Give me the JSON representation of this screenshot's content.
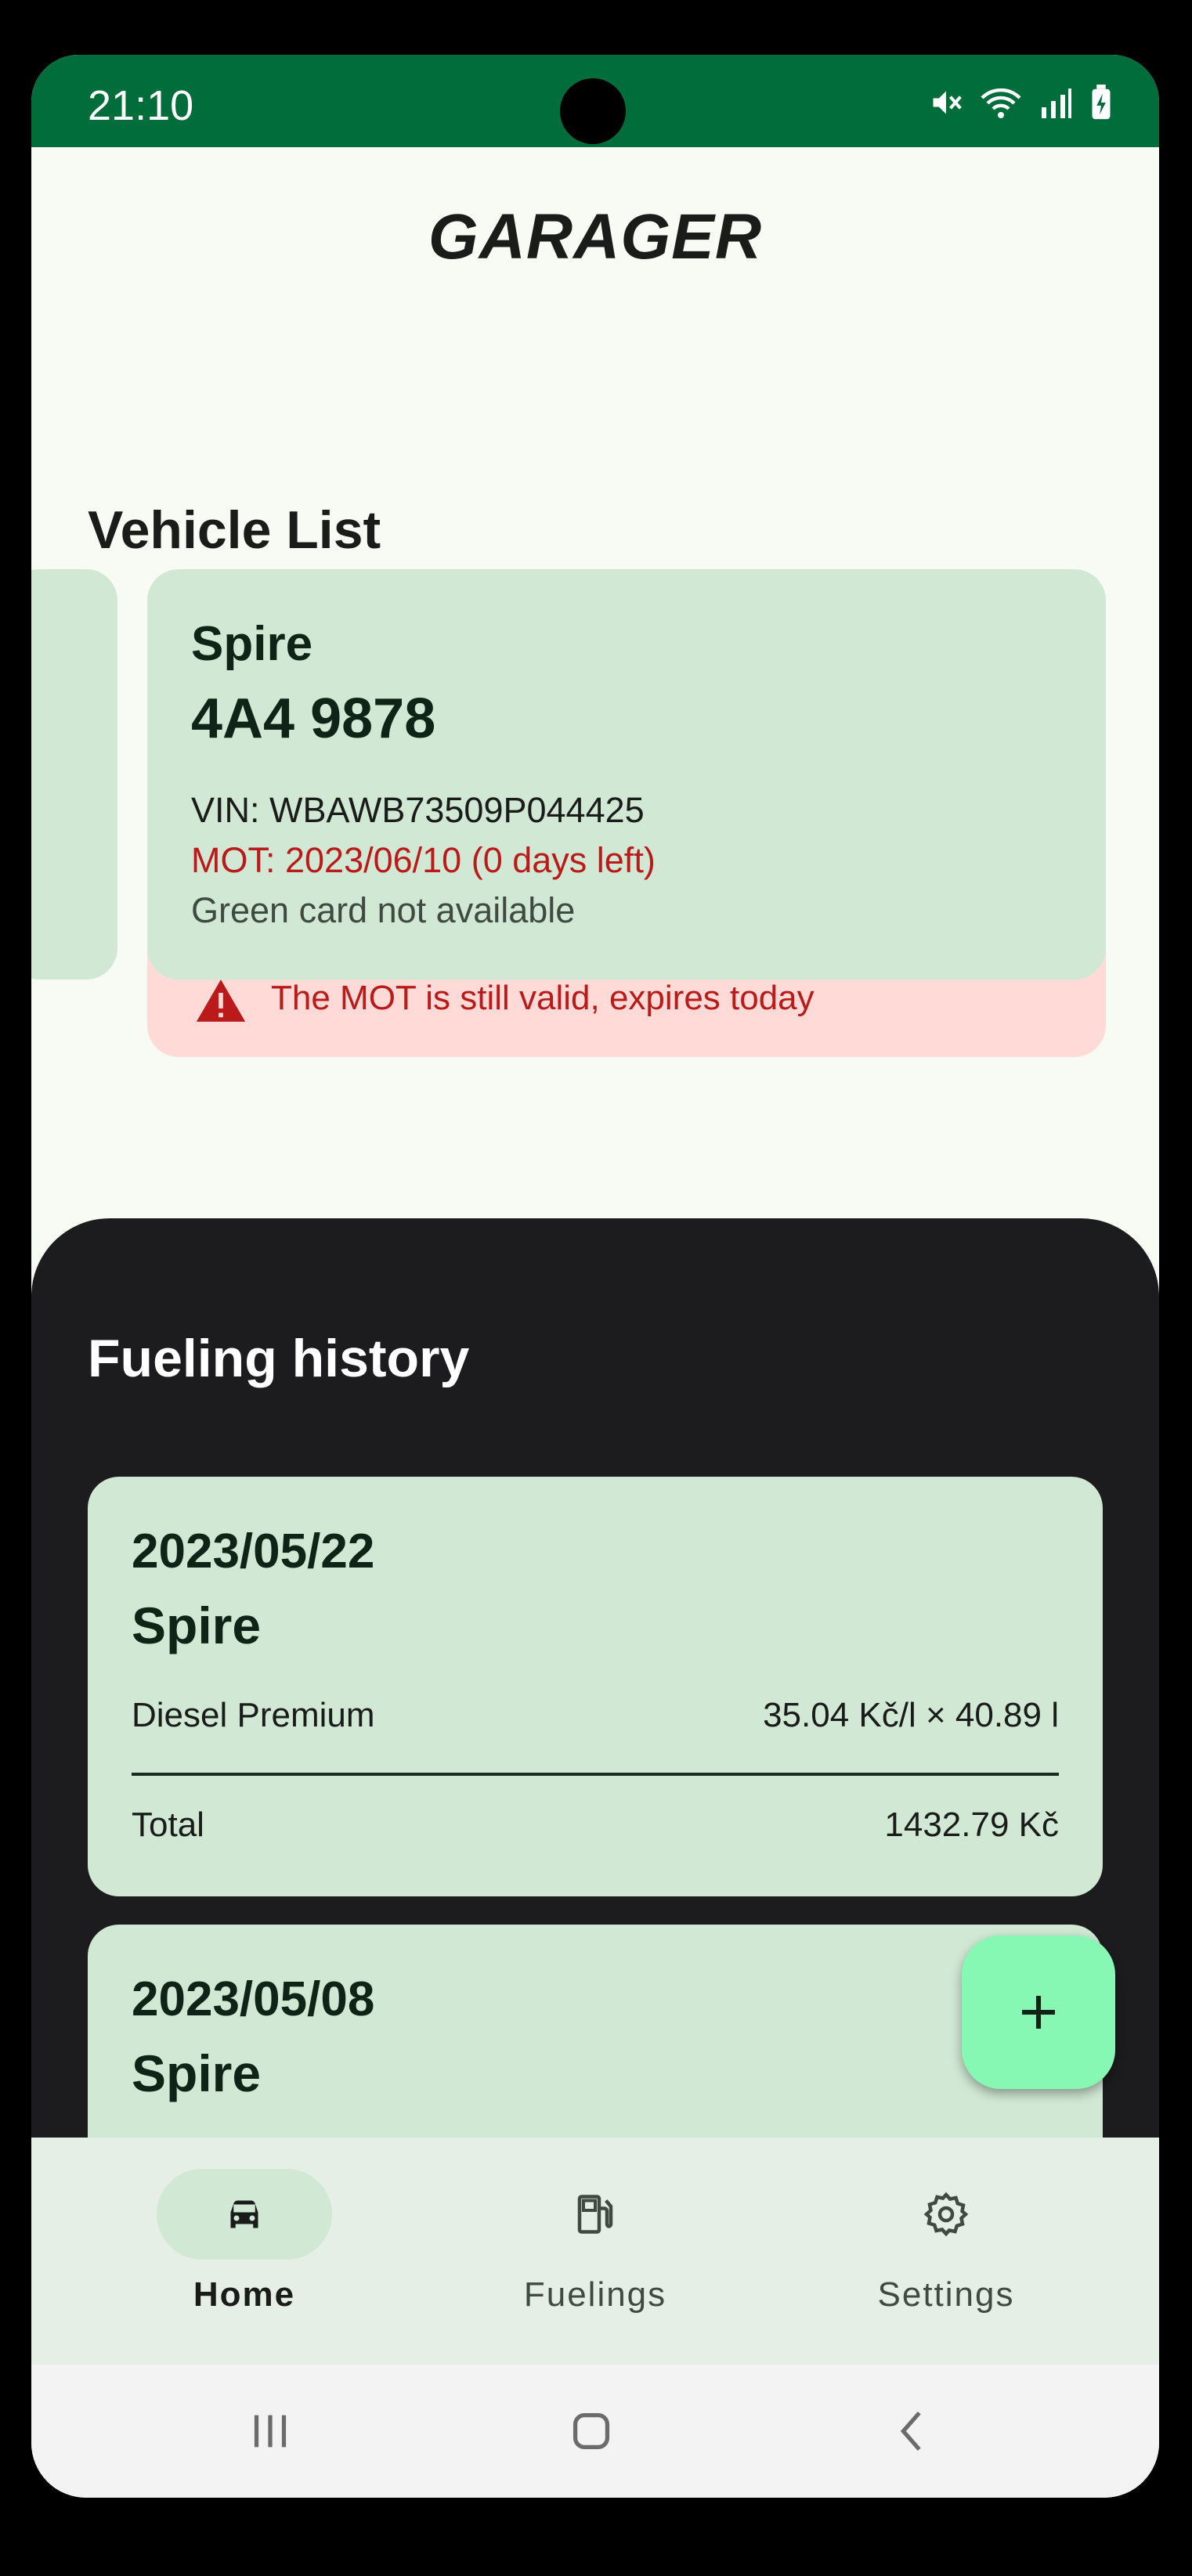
{
  "status_bar": {
    "time": "21:10",
    "icons": [
      "mute-icon",
      "wifi-icon",
      "signal-icon",
      "battery-charging-icon"
    ]
  },
  "app": {
    "title": "GARAGER"
  },
  "vehicle_list": {
    "title": "Vehicle List",
    "vehicles": [
      {
        "name": "Spire",
        "plate": "4A4 9878",
        "vin": "VIN: WBAWB73509P044425",
        "mot": "MOT: 2023/06/10 (0 days left)",
        "green_card": "Green card not available",
        "warning": "The MOT is still valid, expires today"
      }
    ]
  },
  "fueling_history": {
    "title": "Fueling history",
    "entries": [
      {
        "date": "2023/05/22",
        "vehicle": "Spire",
        "fuel_type": "Diesel Premium",
        "calculation": "35.04 Kč/l × 40.89 l",
        "total_label": "Total",
        "total_value": "1432.79 Kč"
      },
      {
        "date": "2023/05/08",
        "vehicle": "Spire"
      }
    ]
  },
  "fab": {
    "icon": "plus-icon"
  },
  "bottom_nav": {
    "items": [
      {
        "label": "Home",
        "icon": "car-icon",
        "active": true
      },
      {
        "label": "Fuelings",
        "icon": "fuel-pump-icon",
        "active": false
      },
      {
        "label": "Settings",
        "icon": "gear-icon",
        "active": false
      }
    ]
  },
  "system_nav": [
    "recents-icon",
    "home-icon",
    "back-icon"
  ],
  "colors": {
    "status_bar": "#006d3b",
    "card": "#d0e8d4",
    "warning_bg": "#ffdad6",
    "error": "#ba1a1a",
    "dark_sheet": "#1c1c1e",
    "fab": "#86f8b3",
    "nav_bg": "#e6efe6"
  }
}
